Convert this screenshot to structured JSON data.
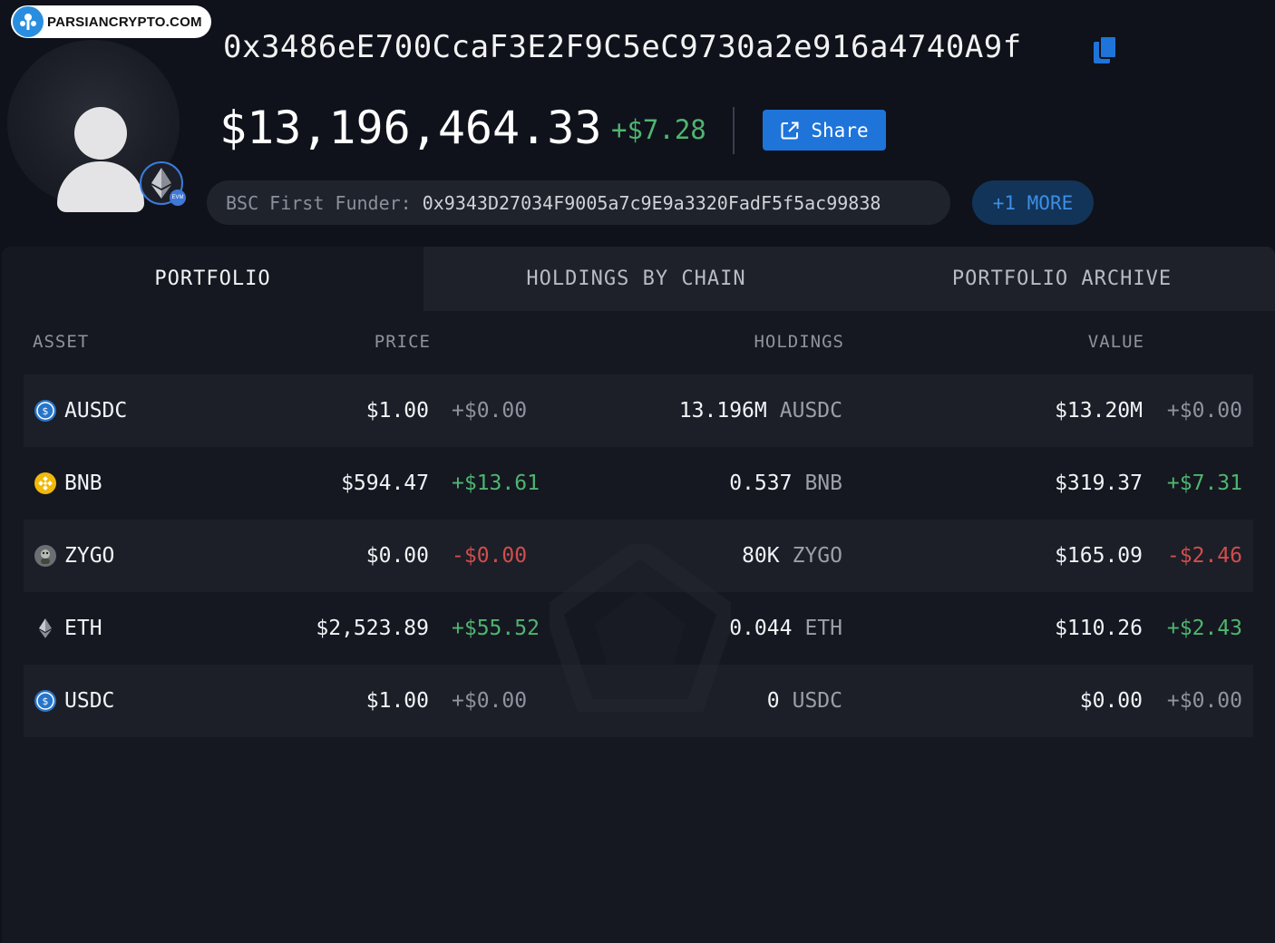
{
  "watermark": {
    "text": "PARSIANCRYPTO.COM"
  },
  "header": {
    "address": "0x3486eE700CcaF3E2F9C5eC9730a2e916a4740A9f",
    "balance": "$13,196,464.33",
    "balance_change": "+$7.28",
    "share_label": "Share",
    "funder_label": "BSC First Funder:",
    "funder_address": "0x9343D27034F9005a7c9E9a3320FadF5f5ac99838",
    "more_label": "+1 MORE",
    "chain_badge": "EVM"
  },
  "tabs": [
    {
      "label": "PORTFOLIO",
      "active": true
    },
    {
      "label": "HOLDINGS BY CHAIN",
      "active": false
    },
    {
      "label": "PORTFOLIO ARCHIVE",
      "active": false
    }
  ],
  "table": {
    "headers": {
      "asset": "ASSET",
      "price": "PRICE",
      "holdings": "HOLDINGS",
      "value": "VALUE"
    },
    "rows": [
      {
        "symbol": "AUSDC",
        "icon": "usdc-icon",
        "price": "$1.00",
        "price_change": "+$0.00",
        "price_trend": "neutral",
        "holdings": "13.196M",
        "unit": "AUSDC",
        "value": "$13.20M",
        "value_change": "+$0.00",
        "value_trend": "neutral"
      },
      {
        "symbol": "BNB",
        "icon": "bnb-icon",
        "price": "$594.47",
        "price_change": "+$13.61",
        "price_trend": "pos",
        "holdings": "0.537",
        "unit": "BNB",
        "value": "$319.37",
        "value_change": "+$7.31",
        "value_trend": "pos"
      },
      {
        "symbol": "ZYGO",
        "icon": "zygo-icon",
        "price": "$0.00",
        "price_change": "-$0.00",
        "price_trend": "neg",
        "holdings": "80K",
        "unit": "ZYGO",
        "value": "$165.09",
        "value_change": "-$2.46",
        "value_trend": "neg"
      },
      {
        "symbol": "ETH",
        "icon": "eth-icon",
        "price": "$2,523.89",
        "price_change": "+$55.52",
        "price_trend": "pos",
        "holdings": "0.044",
        "unit": "ETH",
        "value": "$110.26",
        "value_change": "+$2.43",
        "value_trend": "pos"
      },
      {
        "symbol": "USDC",
        "icon": "usdc-icon",
        "price": "$1.00",
        "price_change": "+$0.00",
        "price_trend": "neutral",
        "holdings": "0",
        "unit": "USDC",
        "value": "$0.00",
        "value_change": "+$0.00",
        "value_trend": "neutral"
      }
    ]
  },
  "colors": {
    "positive": "#4fb570",
    "negative": "#d24d4d",
    "accent": "#1e74d9",
    "background": "#0f121b"
  }
}
